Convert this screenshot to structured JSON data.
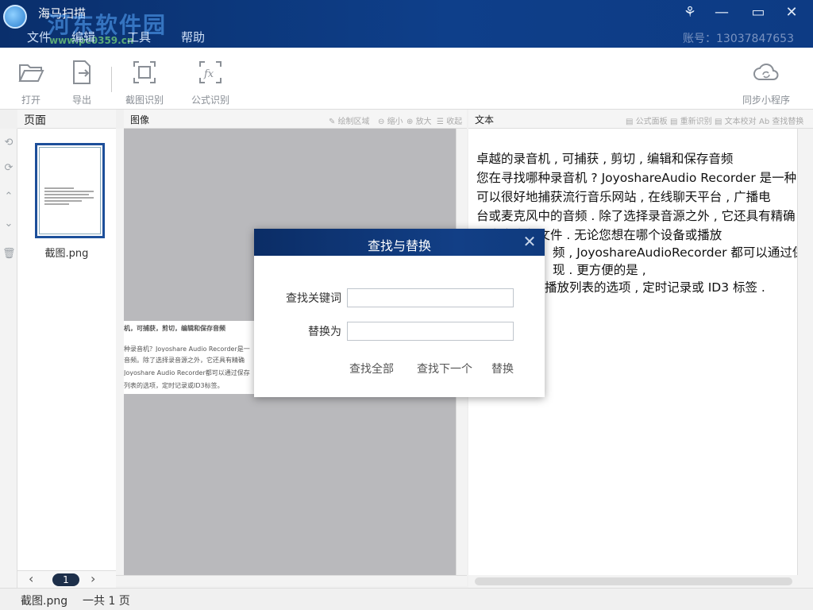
{
  "app": {
    "title": "海马扫描",
    "watermark": "河东软件园",
    "watermark_url": "www.pc0359.cn",
    "menu": [
      "文件",
      "编辑",
      "工具",
      "帮助"
    ],
    "account": "账号：13037847653"
  },
  "window_controls": {
    "skin": "⚘",
    "minimize": "—",
    "maximize": "▭",
    "close": "✕"
  },
  "toolbar": {
    "open": "打开",
    "export": "导出",
    "screenshot_ocr": "截图识别",
    "formula_ocr": "公式识别",
    "sync": "同步小程序"
  },
  "page_panel": {
    "header": "页面",
    "thumb_label": "截图.png",
    "current_page": "1",
    "prev": "‹",
    "next": "›"
  },
  "image_panel": {
    "header": "图像",
    "tools": [
      "绘制区域",
      "缩小",
      "放大",
      "收起"
    ],
    "scan_lines": [
      "机，可捕获，剪切，编辑和保存音频",
      "种录音机？Joyoshare Audio Recorder是一",
      "音频。除了选择录音源之外，它还具有精确",
      "Joyoshare Audio Recorder都可以通过保存",
      "列表的选项，定时记录或ID3标签。"
    ]
  },
  "text_panel": {
    "header": "文本",
    "tools": [
      "公式面板",
      "重新识别",
      "文本校对",
      "查找替换"
    ],
    "lines": [
      "   卓越的录音机 , 可捕获 , 剪切 , 编辑和保存音频",
      "   您在寻找哪种录音机 ? JoyoshareAudio Recorder 是一种",
      "可以很好地捕获流行音乐网站 , 在线聊天平台 , 广播电",
      "台或麦克风中的音频 . 除了选择录音源之外 , 它还具有精确",
      "以丰富音频文件 . 无论您想在哪个设备或播放",
      "频 , JoyoshareAudioRecorder 都可以通过保存",
      "现 . 更方便的是 ,",
      "播放列表的选项 , 定时记录或 ID3 标签 ."
    ]
  },
  "status": {
    "file": "截图.png",
    "count": "一共 1 页"
  },
  "dialog": {
    "title": "查找与替换",
    "find_label": "查找关键词",
    "replace_label": "替换为",
    "find_value": "",
    "replace_value": "",
    "find_all": "查找全部",
    "find_next": "查找下一个",
    "replace": "替换",
    "close": "✕"
  }
}
